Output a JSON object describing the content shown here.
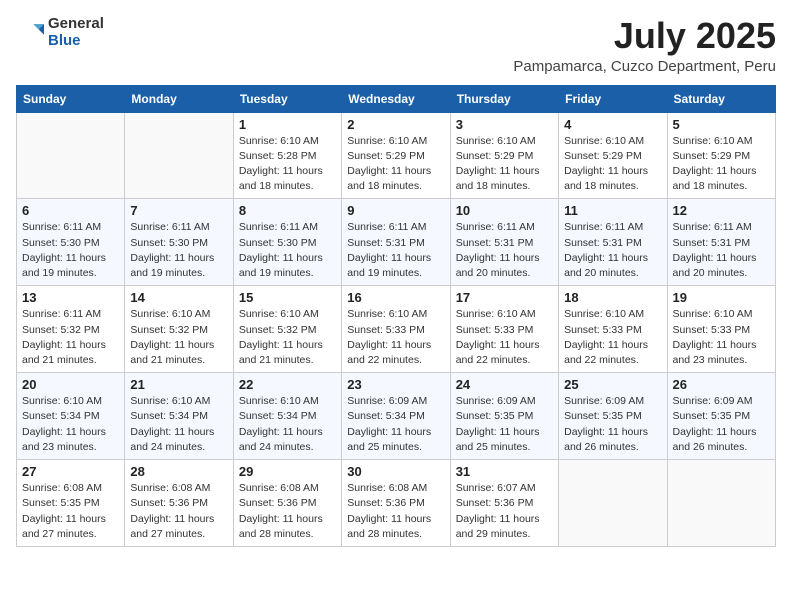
{
  "header": {
    "logo_general": "General",
    "logo_blue": "Blue",
    "title": "July 2025",
    "subtitle": "Pampamarca, Cuzco Department, Peru"
  },
  "weekdays": [
    "Sunday",
    "Monday",
    "Tuesday",
    "Wednesday",
    "Thursday",
    "Friday",
    "Saturday"
  ],
  "weeks": [
    [
      {
        "day": "",
        "info": ""
      },
      {
        "day": "",
        "info": ""
      },
      {
        "day": "1",
        "info": "Sunrise: 6:10 AM\nSunset: 5:28 PM\nDaylight: 11 hours and 18 minutes."
      },
      {
        "day": "2",
        "info": "Sunrise: 6:10 AM\nSunset: 5:29 PM\nDaylight: 11 hours and 18 minutes."
      },
      {
        "day": "3",
        "info": "Sunrise: 6:10 AM\nSunset: 5:29 PM\nDaylight: 11 hours and 18 minutes."
      },
      {
        "day": "4",
        "info": "Sunrise: 6:10 AM\nSunset: 5:29 PM\nDaylight: 11 hours and 18 minutes."
      },
      {
        "day": "5",
        "info": "Sunrise: 6:10 AM\nSunset: 5:29 PM\nDaylight: 11 hours and 18 minutes."
      }
    ],
    [
      {
        "day": "6",
        "info": "Sunrise: 6:11 AM\nSunset: 5:30 PM\nDaylight: 11 hours and 19 minutes."
      },
      {
        "day": "7",
        "info": "Sunrise: 6:11 AM\nSunset: 5:30 PM\nDaylight: 11 hours and 19 minutes."
      },
      {
        "day": "8",
        "info": "Sunrise: 6:11 AM\nSunset: 5:30 PM\nDaylight: 11 hours and 19 minutes."
      },
      {
        "day": "9",
        "info": "Sunrise: 6:11 AM\nSunset: 5:31 PM\nDaylight: 11 hours and 19 minutes."
      },
      {
        "day": "10",
        "info": "Sunrise: 6:11 AM\nSunset: 5:31 PM\nDaylight: 11 hours and 20 minutes."
      },
      {
        "day": "11",
        "info": "Sunrise: 6:11 AM\nSunset: 5:31 PM\nDaylight: 11 hours and 20 minutes."
      },
      {
        "day": "12",
        "info": "Sunrise: 6:11 AM\nSunset: 5:31 PM\nDaylight: 11 hours and 20 minutes."
      }
    ],
    [
      {
        "day": "13",
        "info": "Sunrise: 6:11 AM\nSunset: 5:32 PM\nDaylight: 11 hours and 21 minutes."
      },
      {
        "day": "14",
        "info": "Sunrise: 6:10 AM\nSunset: 5:32 PM\nDaylight: 11 hours and 21 minutes."
      },
      {
        "day": "15",
        "info": "Sunrise: 6:10 AM\nSunset: 5:32 PM\nDaylight: 11 hours and 21 minutes."
      },
      {
        "day": "16",
        "info": "Sunrise: 6:10 AM\nSunset: 5:33 PM\nDaylight: 11 hours and 22 minutes."
      },
      {
        "day": "17",
        "info": "Sunrise: 6:10 AM\nSunset: 5:33 PM\nDaylight: 11 hours and 22 minutes."
      },
      {
        "day": "18",
        "info": "Sunrise: 6:10 AM\nSunset: 5:33 PM\nDaylight: 11 hours and 22 minutes."
      },
      {
        "day": "19",
        "info": "Sunrise: 6:10 AM\nSunset: 5:33 PM\nDaylight: 11 hours and 23 minutes."
      }
    ],
    [
      {
        "day": "20",
        "info": "Sunrise: 6:10 AM\nSunset: 5:34 PM\nDaylight: 11 hours and 23 minutes."
      },
      {
        "day": "21",
        "info": "Sunrise: 6:10 AM\nSunset: 5:34 PM\nDaylight: 11 hours and 24 minutes."
      },
      {
        "day": "22",
        "info": "Sunrise: 6:10 AM\nSunset: 5:34 PM\nDaylight: 11 hours and 24 minutes."
      },
      {
        "day": "23",
        "info": "Sunrise: 6:09 AM\nSunset: 5:34 PM\nDaylight: 11 hours and 25 minutes."
      },
      {
        "day": "24",
        "info": "Sunrise: 6:09 AM\nSunset: 5:35 PM\nDaylight: 11 hours and 25 minutes."
      },
      {
        "day": "25",
        "info": "Sunrise: 6:09 AM\nSunset: 5:35 PM\nDaylight: 11 hours and 26 minutes."
      },
      {
        "day": "26",
        "info": "Sunrise: 6:09 AM\nSunset: 5:35 PM\nDaylight: 11 hours and 26 minutes."
      }
    ],
    [
      {
        "day": "27",
        "info": "Sunrise: 6:08 AM\nSunset: 5:35 PM\nDaylight: 11 hours and 27 minutes."
      },
      {
        "day": "28",
        "info": "Sunrise: 6:08 AM\nSunset: 5:36 PM\nDaylight: 11 hours and 27 minutes."
      },
      {
        "day": "29",
        "info": "Sunrise: 6:08 AM\nSunset: 5:36 PM\nDaylight: 11 hours and 28 minutes."
      },
      {
        "day": "30",
        "info": "Sunrise: 6:08 AM\nSunset: 5:36 PM\nDaylight: 11 hours and 28 minutes."
      },
      {
        "day": "31",
        "info": "Sunrise: 6:07 AM\nSunset: 5:36 PM\nDaylight: 11 hours and 29 minutes."
      },
      {
        "day": "",
        "info": ""
      },
      {
        "day": "",
        "info": ""
      }
    ]
  ]
}
